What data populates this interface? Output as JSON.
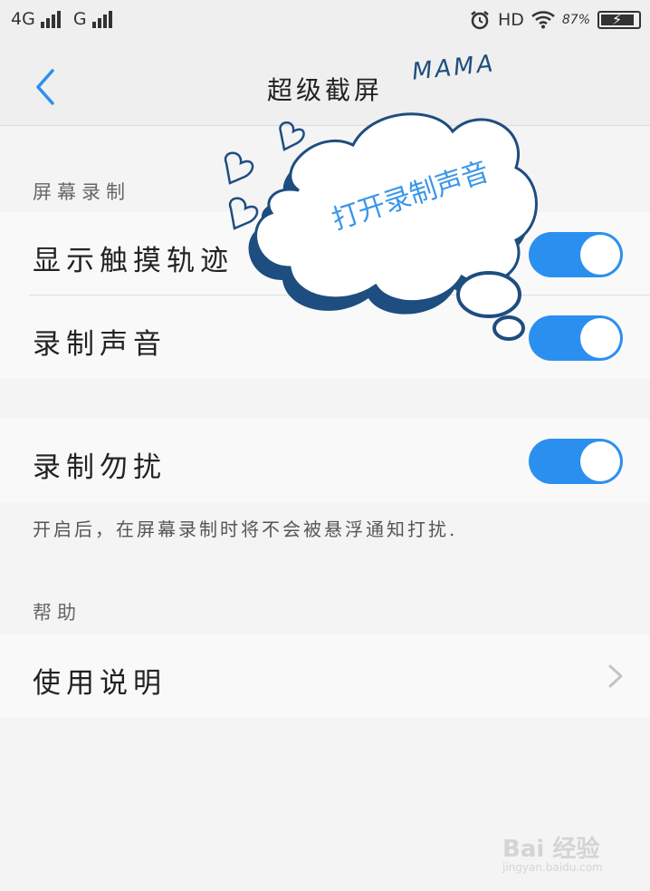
{
  "status_bar": {
    "network_primary": "4G",
    "network_secondary": "G",
    "hd_label": "HD",
    "battery_percent": "87%",
    "battery_level": 0.87,
    "icons": [
      "signal-bars-icon",
      "alarm-clock-icon",
      "wifi-icon",
      "battery-charging-icon"
    ]
  },
  "header": {
    "title": "超级截屏",
    "back_icon": "chevron-left-icon",
    "accent_color": "#2b8ff0"
  },
  "sections": {
    "screen_recording": {
      "label": "屏幕录制",
      "items": [
        {
          "label": "显示触摸轨迹",
          "enabled": true
        },
        {
          "label": "录制声音",
          "enabled": true
        }
      ]
    },
    "dnd": {
      "label": "录制勿扰",
      "enabled": true,
      "hint": "开启后，在屏幕录制时将不会被悬浮通知打扰."
    },
    "help": {
      "label": "帮助",
      "item": "使用说明",
      "chevron_icon": "chevron-right-icon"
    }
  },
  "overlay": {
    "sticker_text": "MAMA",
    "callout_text": "打开录制声音",
    "callout_color": "#3a97e8",
    "outline_color": "#1e4d80"
  },
  "watermark": {
    "text": "Bai 经验",
    "url": "jingyan.baidu.com"
  }
}
